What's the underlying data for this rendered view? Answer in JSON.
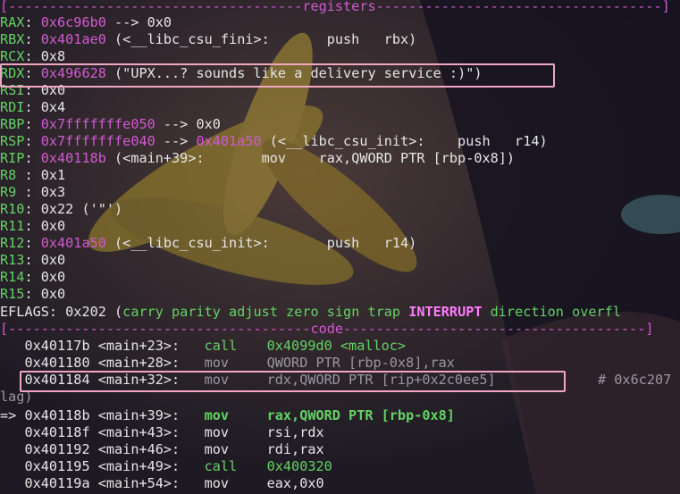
{
  "registers_header": "[------------------------------------registers-----------------------------------]",
  "registers": [
    {
      "name": "RAX",
      "sep": ": ",
      "value": "0x6c96b0",
      "rest": " --> 0x0"
    },
    {
      "name": "RBX",
      "sep": ": ",
      "value": "0x401ae0",
      "rest": " (<__libc_csu_fini>:\tpush   rbx)"
    },
    {
      "name": "RCX",
      "sep": ": ",
      "value": "",
      "rest": "0x8"
    },
    {
      "name": "RDX",
      "sep": ": ",
      "value": "0x496628",
      "rest": " (\"UPX...? sounds like a delivery service :)\")"
    },
    {
      "name": "RSI",
      "sep": ": ",
      "value": "",
      "rest": "0x0"
    },
    {
      "name": "RDI",
      "sep": ": ",
      "value": "",
      "rest": "0x4"
    },
    {
      "name": "RBP",
      "sep": ": ",
      "value": "0x7fffffffe050",
      "rest": " --> 0x0"
    },
    {
      "name": "RSP",
      "sep": ": ",
      "value": "0x7fffffffe040",
      "rest": " --> ",
      "value2": "0x401a50",
      "rest2": " (<__libc_csu_init>:\tpush   r14)"
    },
    {
      "name": "RIP",
      "sep": ": ",
      "value": "0x40118b",
      "rest": " (<main+39>:\tmov    rax,QWORD PTR [rbp-0x8])"
    },
    {
      "name": "R8 ",
      "sep": ": ",
      "value": "",
      "rest": "0x1"
    },
    {
      "name": "R9 ",
      "sep": ": ",
      "value": "",
      "rest": "0x3"
    },
    {
      "name": "R10",
      "sep": ": ",
      "value": "",
      "rest": "0x22 ('\"')"
    },
    {
      "name": "R11",
      "sep": ": ",
      "value": "",
      "rest": "0x0"
    },
    {
      "name": "R12",
      "sep": ": ",
      "value": "0x401a50",
      "rest": " (<__libc_csu_init>:\tpush   r14)"
    },
    {
      "name": "R13",
      "sep": ": ",
      "value": "",
      "rest": "0x0"
    },
    {
      "name": "R14",
      "sep": ": ",
      "value": "",
      "rest": "0x0"
    },
    {
      "name": "R15",
      "sep": ": ",
      "value": "",
      "rest": "0x0"
    }
  ],
  "eflags": {
    "name": "EFLAGS",
    "value": ": 0x202 (",
    "flags_before": "carry parity adjust zero sign trap ",
    "flag_set": "INTERRUPT",
    "flags_after": " direction overfl",
    "wrap": "lag)"
  },
  "code_header": "[-------------------------------------code-------------------------------------]",
  "code": [
    {
      "marker": "   ",
      "addr": "0x40117b",
      "sym": "<main+23>:",
      "op": "call",
      "args": "0x4099d0 <malloc>",
      "style": "past-call"
    },
    {
      "marker": "   ",
      "addr": "0x401180",
      "sym": "<main+28>:",
      "op": "mov",
      "args": "QWORD PTR [rbp-0x8],rax",
      "style": "past"
    },
    {
      "marker": "   ",
      "addr": "0x401184",
      "sym": "<main+32>:",
      "op": "mov",
      "args": "rdx,QWORD PTR [rip+0x2c0ee5]",
      "comment": "# 0x6c207",
      "style": "past"
    },
    {
      "marker": "=> ",
      "addr": "0x40118b",
      "sym": "<main+39>:",
      "op": "mov",
      "args": "rax,QWORD PTR [rbp-0x8]",
      "style": "current"
    },
    {
      "marker": "   ",
      "addr": "0x40118f",
      "sym": "<main+43>:",
      "op": "mov",
      "args": "rsi,rdx",
      "style": "next"
    },
    {
      "marker": "   ",
      "addr": "0x401192",
      "sym": "<main+46>:",
      "op": "mov",
      "args": "rdi,rax",
      "style": "next"
    },
    {
      "marker": "   ",
      "addr": "0x401195",
      "sym": "<main+49>:",
      "op": "call",
      "args": "0x400320",
      "style": "next-call"
    },
    {
      "marker": "   ",
      "addr": "0x40119a",
      "sym": "<main+54>:",
      "op": "mov",
      "args": "eax,0x0",
      "style": "next"
    }
  ],
  "colors": {
    "register": "#64d264",
    "pointer": "#d25ad2",
    "text": "#e6e6e6",
    "highlight_box": "#f2a6c2"
  }
}
